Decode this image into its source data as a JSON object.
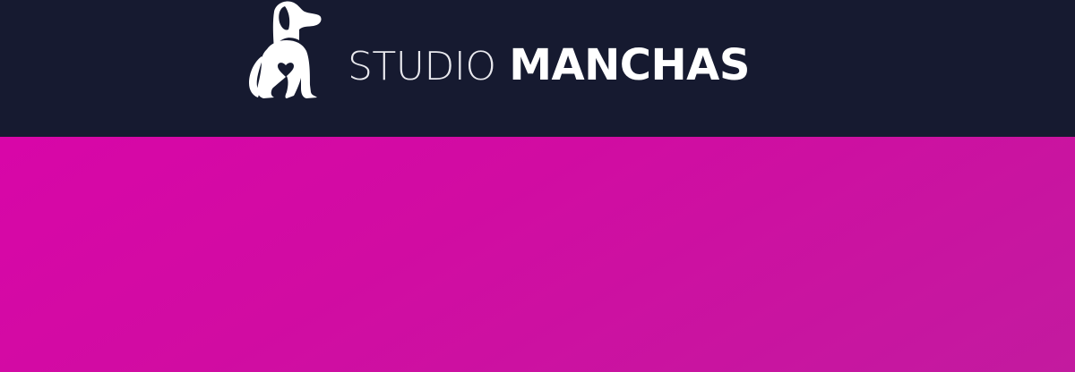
{
  "header": {
    "logo_icon": "dog-with-heart-icon",
    "brand_light": "STUDIO",
    "brand_bold": "MANCHAS"
  },
  "colors": {
    "header_bg": "#161a30",
    "hero_start": "#d806a8",
    "hero_end": "#c31a9f",
    "text": "#ffffff"
  }
}
